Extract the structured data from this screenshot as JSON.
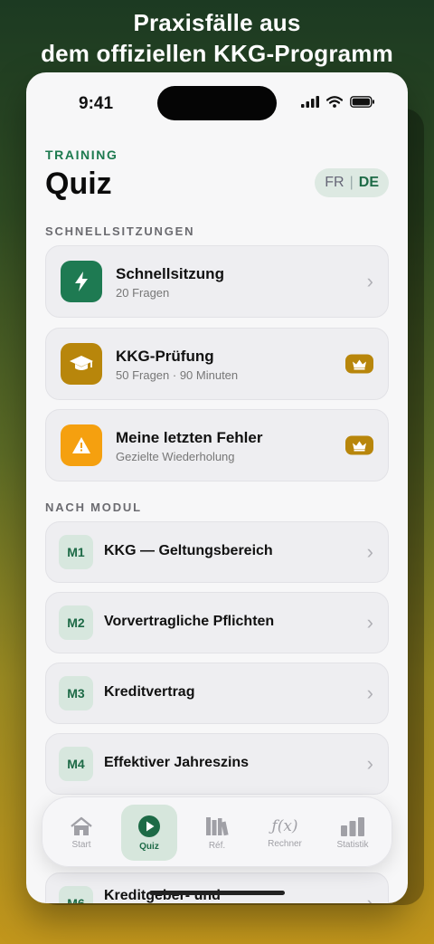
{
  "headline": {
    "line1": "Praxisfälle aus",
    "line2": "dem offiziellen KKG-Programm"
  },
  "status": {
    "time": "9:41"
  },
  "header": {
    "kicker": "TRAINING",
    "title": "Quiz",
    "lang_fr": "FR",
    "lang_sep": "|",
    "lang_de": "DE",
    "lang_selected": "DE"
  },
  "quick": {
    "label": "SCHNELLSITZUNGEN",
    "items": [
      {
        "name": "Schnellsitzung",
        "sub": "20 Fragen",
        "icon": "lightning-icon",
        "color": "#1e7a52",
        "premium": false
      },
      {
        "name": "KKG-Prüfung",
        "sub": "50 Fragen · 90 Minuten",
        "icon": "graduation-cap-icon",
        "color": "#b8860b",
        "premium": true
      },
      {
        "name": "Meine letzten Fehler",
        "sub": "Gezielte Wiederholung",
        "icon": "warning-icon",
        "color": "#f5a00f",
        "premium": true
      }
    ]
  },
  "modules": {
    "label": "NACH MODUL",
    "items": [
      {
        "badge": "M1",
        "name": "KKG — Geltungsbereich"
      },
      {
        "badge": "M2",
        "name": "Vorvertragliche Pflichten"
      },
      {
        "badge": "M3",
        "name": "Kreditvertrag"
      },
      {
        "badge": "M4",
        "name": "Effektiver Jahreszins"
      },
      {
        "badge": "M6",
        "name": "Kreditgeber- und"
      }
    ]
  },
  "tabs": [
    {
      "label": "Start",
      "icon": "home-icon",
      "active": false
    },
    {
      "label": "Quiz",
      "icon": "play-icon",
      "active": true
    },
    {
      "label": "Réf.",
      "icon": "books-icon",
      "active": false
    },
    {
      "label": "Rechner",
      "icon": "function-icon",
      "active": false,
      "glyph": "ƒ(x)"
    },
    {
      "label": "Statistik",
      "icon": "bar-chart-icon",
      "active": false
    }
  ],
  "colors": {
    "accent": "#1d6a46",
    "premium": "#b8860b",
    "warning": "#f5a00f"
  }
}
